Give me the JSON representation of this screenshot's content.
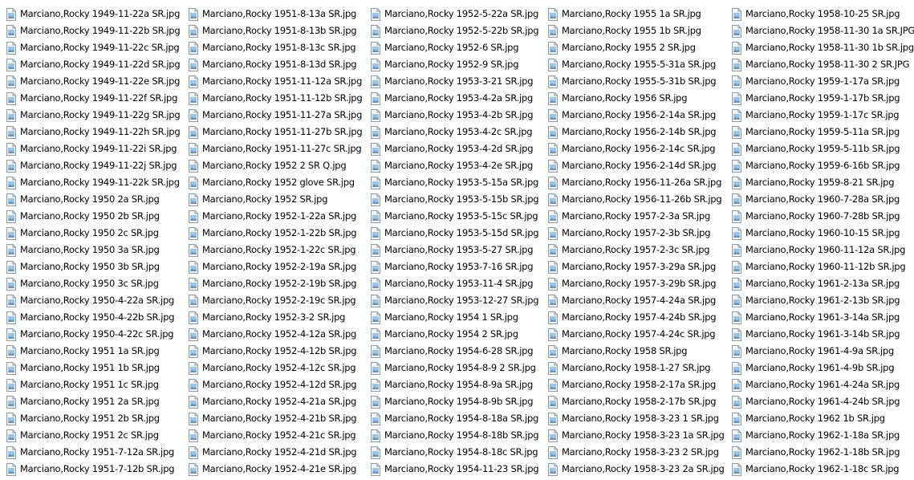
{
  "file_list": {
    "columns": [
      {
        "items": [
          {
            "name": "Marciano,Rocky 1949-11-22a SR.jpg"
          },
          {
            "name": "Marciano,Rocky 1949-11-22b SR.jpg"
          },
          {
            "name": "Marciano,Rocky 1949-11-22c SR.jpg"
          },
          {
            "name": "Marciano,Rocky 1949-11-22d SR.jpg"
          },
          {
            "name": "Marciano,Rocky 1949-11-22e SR.jpg"
          },
          {
            "name": "Marciano,Rocky 1949-11-22f SR.jpg"
          },
          {
            "name": "Marciano,Rocky 1949-11-22g SR.jpg"
          },
          {
            "name": "Marciano,Rocky 1949-11-22h SR.jpg"
          },
          {
            "name": "Marciano,Rocky 1949-11-22i SR.jpg"
          },
          {
            "name": "Marciano,Rocky 1949-11-22j SR.jpg"
          },
          {
            "name": "Marciano,Rocky 1949-11-22k SR.jpg"
          },
          {
            "name": "Marciano,Rocky 1950 2a SR.jpg"
          },
          {
            "name": "Marciano,Rocky 1950 2b SR.jpg"
          },
          {
            "name": "Marciano,Rocky 1950 2c SR.jpg"
          },
          {
            "name": "Marciano,Rocky 1950 3a SR.jpg"
          },
          {
            "name": "Marciano,Rocky 1950 3b SR.jpg"
          },
          {
            "name": "Marciano,Rocky 1950 3c SR.jpg"
          },
          {
            "name": "Marciano,Rocky 1950-4-22a SR.jpg"
          },
          {
            "name": "Marciano,Rocky 1950-4-22b SR.jpg"
          },
          {
            "name": "Marciano,Rocky 1950-4-22c SR.jpg"
          },
          {
            "name": "Marciano,Rocky 1951 1a SR.jpg"
          },
          {
            "name": "Marciano,Rocky 1951 1b SR.jpg"
          },
          {
            "name": "Marciano,Rocky 1951 1c SR.jpg"
          },
          {
            "name": "Marciano,Rocky 1951 2a SR.jpg"
          },
          {
            "name": "Marciano,Rocky 1951 2b SR.jpg"
          },
          {
            "name": "Marciano,Rocky 1951 2c SR.jpg"
          },
          {
            "name": "Marciano,Rocky 1951-7-12a SR.jpg"
          },
          {
            "name": "Marciano,Rocky 1951-7-12b SR.jpg"
          }
        ]
      },
      {
        "items": [
          {
            "name": "Marciano,Rocky 1951-8-13a SR.jpg"
          },
          {
            "name": "Marciano,Rocky 1951-8-13b SR.jpg"
          },
          {
            "name": "Marciano,Rocky 1951-8-13c SR.jpg"
          },
          {
            "name": "Marciano,Rocky 1951-8-13d SR.jpg"
          },
          {
            "name": "Marciano,Rocky 1951-11-12a SR.jpg"
          },
          {
            "name": "Marciano,Rocky 1951-11-12b SR.jpg"
          },
          {
            "name": "Marciano,Rocky 1951-11-27a SR.jpg"
          },
          {
            "name": "Marciano,Rocky 1951-11-27b SR.jpg"
          },
          {
            "name": "Marciano,Rocky 1951-11-27c SR.jpg"
          },
          {
            "name": "Marciano,Rocky 1952 2 SR Q.jpg"
          },
          {
            "name": "Marciano,Rocky 1952 glove SR.jpg"
          },
          {
            "name": "Marciano,Rocky 1952 SR.jpg"
          },
          {
            "name": "Marciano,Rocky 1952-1-22a SR.jpg"
          },
          {
            "name": "Marciano,Rocky 1952-1-22b SR.jpg"
          },
          {
            "name": "Marciano,Rocky 1952-1-22c SR.jpg"
          },
          {
            "name": "Marciano,Rocky 1952-2-19a SR.jpg"
          },
          {
            "name": "Marciano,Rocky 1952-2-19b SR.jpg"
          },
          {
            "name": "Marciano,Rocky 1952-2-19c SR.jpg"
          },
          {
            "name": "Marciano,Rocky 1952-3-2 SR.jpg"
          },
          {
            "name": "Marciano,Rocky 1952-4-12a SR.jpg"
          },
          {
            "name": "Marciano,Rocky 1952-4-12b SR.jpg"
          },
          {
            "name": "Marciano,Rocky 1952-4-12c SR.jpg"
          },
          {
            "name": "Marciano,Rocky 1952-4-12d SR.jpg"
          },
          {
            "name": "Marciano,Rocky 1952-4-21a SR.jpg"
          },
          {
            "name": "Marciano,Rocky 1952-4-21b SR.jpg"
          },
          {
            "name": "Marciano,Rocky 1952-4-21c SR.jpg"
          },
          {
            "name": "Marciano,Rocky 1952-4-21d SR.jpg"
          },
          {
            "name": "Marciano,Rocky 1952-4-21e SR.jpg"
          }
        ]
      },
      {
        "items": [
          {
            "name": "Marciano,Rocky 1952-5-22a SR.jpg"
          },
          {
            "name": "Marciano,Rocky 1952-5-22b SR.jpg"
          },
          {
            "name": "Marciano,Rocky 1952-6 SR.jpg"
          },
          {
            "name": "Marciano,Rocky 1952-9 SR.jpg"
          },
          {
            "name": "Marciano,Rocky 1953-3-21 SR.jpg"
          },
          {
            "name": "Marciano,Rocky 1953-4-2a SR.jpg"
          },
          {
            "name": "Marciano,Rocky 1953-4-2b SR.jpg"
          },
          {
            "name": "Marciano,Rocky 1953-4-2c SR.jpg"
          },
          {
            "name": "Marciano,Rocky 1953-4-2d SR.jpg"
          },
          {
            "name": "Marciano,Rocky 1953-4-2e SR.jpg"
          },
          {
            "name": "Marciano,Rocky 1953-5-15a SR.jpg"
          },
          {
            "name": "Marciano,Rocky 1953-5-15b SR.jpg"
          },
          {
            "name": "Marciano,Rocky 1953-5-15c SR.jpg"
          },
          {
            "name": "Marciano,Rocky 1953-5-15d SR.jpg"
          },
          {
            "name": "Marciano,Rocky 1953-5-27 SR.jpg"
          },
          {
            "name": "Marciano,Rocky 1953-7-16 SR.jpg"
          },
          {
            "name": "Marciano,Rocky 1953-11-4 SR.jpg"
          },
          {
            "name": "Marciano,Rocky 1953-12-27 SR.jpg"
          },
          {
            "name": "Marciano,Rocky 1954 1 SR.jpg"
          },
          {
            "name": "Marciano,Rocky 1954 2 SR.jpg"
          },
          {
            "name": "Marciano,Rocky 1954-6-28 SR.jpg"
          },
          {
            "name": "Marciano,Rocky 1954-8-9 2 SR.jpg"
          },
          {
            "name": "Marciano,Rocky 1954-8-9a SR.jpg"
          },
          {
            "name": "Marciano,Rocky 1954-8-9b SR.jpg"
          },
          {
            "name": "Marciano,Rocky 1954-8-18a SR.jpg"
          },
          {
            "name": "Marciano,Rocky 1954-8-18b SR.jpg"
          },
          {
            "name": "Marciano,Rocky 1954-8-18c SR.jpg"
          },
          {
            "name": "Marciano,Rocky 1954-11-23 SR.jpg"
          }
        ]
      },
      {
        "items": [
          {
            "name": "Marciano,Rocky 1955 1a SR.jpg"
          },
          {
            "name": "Marciano,Rocky 1955 1b SR.jpg"
          },
          {
            "name": "Marciano,Rocky 1955 2 SR.jpg"
          },
          {
            "name": "Marciano,Rocky 1955-5-31a SR.jpg"
          },
          {
            "name": "Marciano,Rocky 1955-5-31b SR.jpg"
          },
          {
            "name": "Marciano,Rocky 1956 SR.jpg"
          },
          {
            "name": "Marciano,Rocky 1956-2-14a SR.jpg"
          },
          {
            "name": "Marciano,Rocky 1956-2-14b SR.jpg"
          },
          {
            "name": "Marciano,Rocky 1956-2-14c SR.jpg"
          },
          {
            "name": "Marciano,Rocky 1956-2-14d SR.jpg"
          },
          {
            "name": "Marciano,Rocky 1956-11-26a SR.jpg"
          },
          {
            "name": "Marciano,Rocky 1956-11-26b SR.jpg"
          },
          {
            "name": "Marciano,Rocky 1957-2-3a SR.jpg"
          },
          {
            "name": "Marciano,Rocky 1957-2-3b SR.jpg"
          },
          {
            "name": "Marciano,Rocky 1957-2-3c SR.jpg"
          },
          {
            "name": "Marciano,Rocky 1957-3-29a SR.jpg"
          },
          {
            "name": "Marciano,Rocky 1957-3-29b SR.jpg"
          },
          {
            "name": "Marciano,Rocky 1957-4-24a SR.jpg"
          },
          {
            "name": "Marciano,Rocky 1957-4-24b SR.jpg"
          },
          {
            "name": "Marciano,Rocky 1957-4-24c SR.jpg"
          },
          {
            "name": "Marciano,Rocky 1958 SR.jpg"
          },
          {
            "name": "Marciano,Rocky 1958-1-27 SR.jpg"
          },
          {
            "name": "Marciano,Rocky 1958-2-17a SR.jpg"
          },
          {
            "name": "Marciano,Rocky 1958-2-17b SR.jpg"
          },
          {
            "name": "Marciano,Rocky 1958-3-23 1 SR.jpg"
          },
          {
            "name": "Marciano,Rocky 1958-3-23 1a SR.jpg"
          },
          {
            "name": "Marciano,Rocky 1958-3-23 2 SR.jpg"
          },
          {
            "name": "Marciano,Rocky 1958-3-23 2a SR.jpg"
          }
        ]
      },
      {
        "items": [
          {
            "name": "Marciano,Rocky 1958-10-25  SR.jpg"
          },
          {
            "name": "Marciano,Rocky 1958-11-30 1a SR.JPG"
          },
          {
            "name": "Marciano,Rocky 1958-11-30 1b SR.jpg"
          },
          {
            "name": "Marciano,Rocky 1958-11-30 2 SR.JPG"
          },
          {
            "name": "Marciano,Rocky 1959-1-17a SR.jpg"
          },
          {
            "name": "Marciano,Rocky 1959-1-17b SR.jpg"
          },
          {
            "name": "Marciano,Rocky 1959-1-17c SR.jpg"
          },
          {
            "name": "Marciano,Rocky 1959-5-11a SR.jpg"
          },
          {
            "name": "Marciano,Rocky 1959-5-11b SR.jpg"
          },
          {
            "name": "Marciano,Rocky 1959-6-16b SR.jpg"
          },
          {
            "name": "Marciano,Rocky 1959-8-21 SR.jpg"
          },
          {
            "name": "Marciano,Rocky 1960-7-28a SR.jpg"
          },
          {
            "name": "Marciano,Rocky 1960-7-28b SR.jpg"
          },
          {
            "name": "Marciano,Rocky 1960-10-15 SR.jpg"
          },
          {
            "name": "Marciano,Rocky 1960-11-12a SR.jpg"
          },
          {
            "name": "Marciano,Rocky 1960-11-12b SR.jpg"
          },
          {
            "name": "Marciano,Rocky 1961-2-13a SR.jpg"
          },
          {
            "name": "Marciano,Rocky 1961-2-13b SR.jpg"
          },
          {
            "name": "Marciano,Rocky 1961-3-14a SR.jpg"
          },
          {
            "name": "Marciano,Rocky 1961-3-14b SR.jpg"
          },
          {
            "name": "Marciano,Rocky 1961-4-9a SR.jpg"
          },
          {
            "name": "Marciano,Rocky 1961-4-9b SR.jpg"
          },
          {
            "name": "Marciano,Rocky 1961-4-24a SR.jpg"
          },
          {
            "name": "Marciano,Rocky 1961-4-24b SR.jpg"
          },
          {
            "name": "Marciano,Rocky 1962 1b SR.jpg"
          },
          {
            "name": "Marciano,Rocky 1962-1-18a SR.jpg"
          },
          {
            "name": "Marciano,Rocky 1962-1-18b SR.jpg"
          },
          {
            "name": "Marciano,Rocky 1962-1-18c SR.jpg"
          }
        ]
      }
    ],
    "file_icon": {
      "name": "image-file-icon",
      "paper_color": "#f4f4f4",
      "border_color": "#8a9aa8",
      "sky_color": "#9cc4e4",
      "land_color": "#6a8fb0"
    }
  }
}
